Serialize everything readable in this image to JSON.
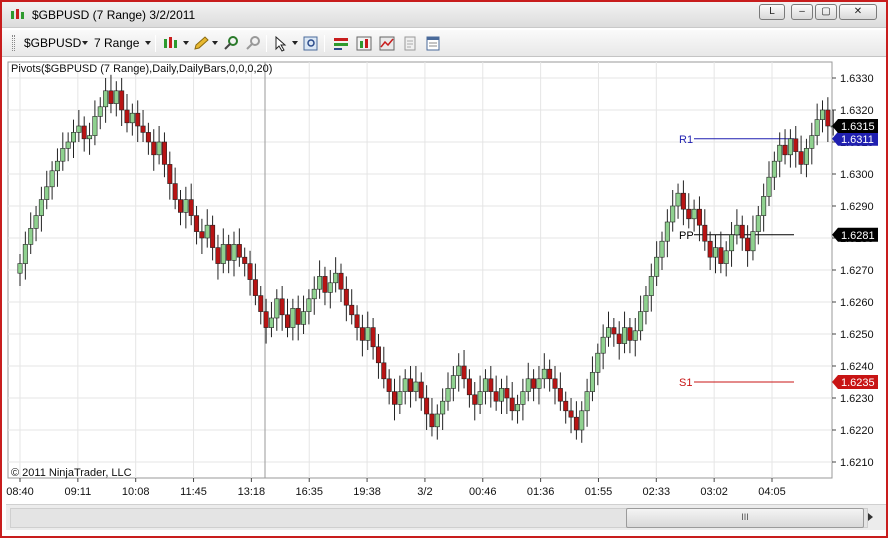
{
  "window": {
    "title": "$GBPUSD (7 Range)  3/2/2011",
    "minimize_label": "–",
    "restore_label": "▢",
    "close_label": "✕",
    "extra_label": "L"
  },
  "toolbar": {
    "instrument": "$GBPUSD",
    "period": "7 Range",
    "icons": [
      "bar-style-icon",
      "drawing-pencil-icon",
      "zoom-in-icon",
      "zoom-out-icon",
      "cursor-icon",
      "data-box-icon",
      "strategies-icon",
      "indicators-icon",
      "chart-trader-icon",
      "print-icon",
      "properties-icon"
    ]
  },
  "chart": {
    "indicator_label": "Pivots($GBPUSD (7 Range),Daily,DailyBars,0,0,0,20)",
    "copyright": "© 2011 NinjaTrader, LLC",
    "colors": {
      "up": "#8fd18f",
      "down": "#b81414",
      "r1": "#1f1fb0",
      "pp": "#000000",
      "s1": "#c81414",
      "grid": "#e5e5e5"
    },
    "chart_data": {
      "type": "candlestick",
      "title": "",
      "ylim": [
        1.6205,
        1.6335
      ],
      "y_ticks": [
        "1.6330",
        "1.6320",
        "1.6310",
        "1.6300",
        "1.6290",
        "1.6280",
        "1.6270",
        "1.6260",
        "1.6250",
        "1.6240",
        "1.6230",
        "1.6220",
        "1.6210"
      ],
      "x_ticks": [
        "08:40",
        "09:11",
        "10:08",
        "11:45",
        "13:18",
        "16:35",
        "19:38",
        "3/2",
        "00:46",
        "01:36",
        "01:55",
        "02:33",
        "03:02",
        "04:05"
      ],
      "pivots": [
        {
          "name": "R1",
          "value": 1.6311,
          "label": "1.6311"
        },
        {
          "name": "PP",
          "value": 1.6281,
          "label": "1.6281"
        },
        {
          "name": "S1",
          "value": 1.6235,
          "label": "1.6235"
        }
      ],
      "last_price": {
        "value": 1.6315,
        "label": "1.6315"
      },
      "closes": [
        1.6272,
        1.6278,
        1.6283,
        1.6287,
        1.6292,
        1.6296,
        1.6301,
        1.6304,
        1.6308,
        1.631,
        1.6313,
        1.6315,
        1.6311,
        1.6312,
        1.6318,
        1.6321,
        1.6326,
        1.6322,
        1.6326,
        1.632,
        1.6316,
        1.6319,
        1.6315,
        1.6313,
        1.631,
        1.6306,
        1.631,
        1.6303,
        1.6297,
        1.6292,
        1.6288,
        1.6292,
        1.6287,
        1.6282,
        1.628,
        1.6284,
        1.6277,
        1.6272,
        1.6278,
        1.6273,
        1.6278,
        1.6274,
        1.6272,
        1.6267,
        1.6262,
        1.6257,
        1.6252,
        1.6255,
        1.6261,
        1.6256,
        1.6252,
        1.6258,
        1.6253,
        1.6257,
        1.6261,
        1.6264,
        1.6268,
        1.6263,
        1.6266,
        1.6269,
        1.6264,
        1.6259,
        1.6256,
        1.6252,
        1.6248,
        1.6252,
        1.6246,
        1.6241,
        1.6236,
        1.6232,
        1.6228,
        1.6232,
        1.6236,
        1.6232,
        1.6235,
        1.623,
        1.6225,
        1.6221,
        1.6225,
        1.6229,
        1.6233,
        1.6237,
        1.624,
        1.6236,
        1.6231,
        1.6228,
        1.6232,
        1.6236,
        1.6232,
        1.6229,
        1.6233,
        1.623,
        1.6226,
        1.6228,
        1.6232,
        1.6236,
        1.6233,
        1.6236,
        1.6239,
        1.6236,
        1.6233,
        1.6229,
        1.6226,
        1.6224,
        1.622,
        1.6226,
        1.6232,
        1.6238,
        1.6244,
        1.6249,
        1.6252,
        1.625,
        1.6247,
        1.6252,
        1.6248,
        1.6251,
        1.6257,
        1.6262,
        1.6268,
        1.6274,
        1.6279,
        1.6285,
        1.629,
        1.6294,
        1.6289,
        1.6286,
        1.6289,
        1.6284,
        1.6279,
        1.6274,
        1.6277,
        1.6272,
        1.6276,
        1.6281,
        1.6284,
        1.628,
        1.6276,
        1.6282,
        1.6287,
        1.6293,
        1.6299,
        1.6304,
        1.6309,
        1.6306,
        1.6311,
        1.6307,
        1.6303,
        1.6308,
        1.6312,
        1.6317,
        1.632,
        1.6315,
        1.6315
      ]
    }
  }
}
